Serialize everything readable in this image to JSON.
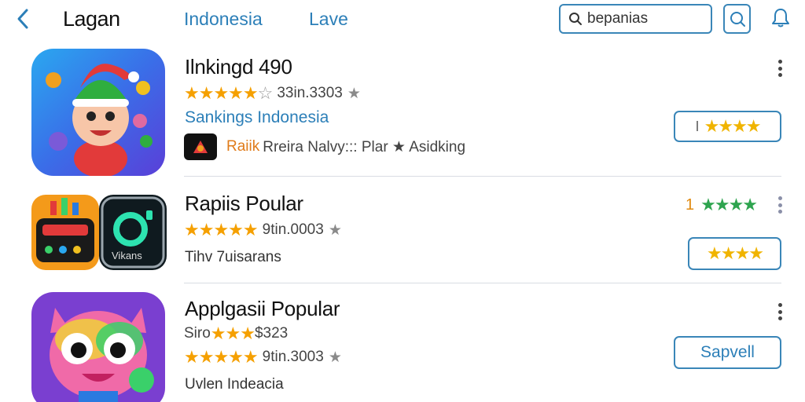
{
  "header": {
    "title": "Lagan",
    "nav": [
      "Indonesia",
      "Lave"
    ],
    "search_value": "bepanias"
  },
  "apps": [
    {
      "title": "Ilnkingd 490",
      "stars_filled": 4.5,
      "rating_text": "33in.3303",
      "subtitle_link": "Sankings Indonesia",
      "developer_name": "Raiik",
      "developer_rest": "Rreira Nalvy::: Plar ★ Asidking",
      "action": {
        "prefix": "I",
        "stars": "★★★★"
      }
    },
    {
      "title": "Rapiis Poular",
      "stars_filled": 5,
      "rating_text": "9tin.0003",
      "green_rating_num": "1",
      "green_rating_stars": "★★★★",
      "subtitle": "Tihv 7uisarans",
      "action": {
        "stars": "★★★★"
      },
      "icon_label": "Vikans"
    },
    {
      "title": "Applgasii Popular",
      "secondary_prefix": "Siro",
      "secondary_stars": "★★★",
      "secondary_price": "$323",
      "stars_filled": 5,
      "rating_text": "9tin.3003",
      "subtitle": "Uvlen Indeacia",
      "action": {
        "label": "Sapvell"
      }
    }
  ],
  "colors": {
    "accent": "#2c7fb8",
    "star": "#f5a000",
    "divider": "#d9dde3"
  }
}
